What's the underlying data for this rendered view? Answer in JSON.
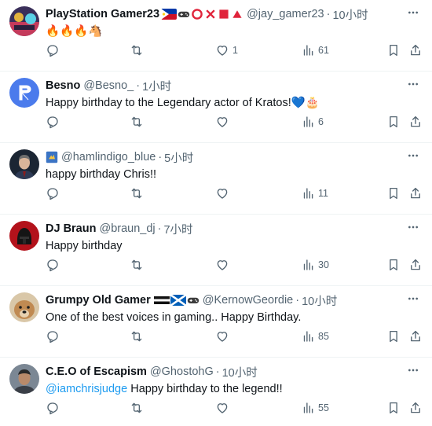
{
  "replies": [
    {
      "name": "PlayStation Gamer23",
      "handle": "@jay_gamer23",
      "dot": "·",
      "time": "10小时",
      "body": "🔥🔥🔥🐴",
      "likes": "1",
      "views": "61",
      "avatar_color": "#3a2f5a"
    },
    {
      "name": "Besno",
      "handle": "@Besno_",
      "dot": "·",
      "time": "1小时",
      "body": "Happy birthday to the Legendary actor of Kratos!💙🎂",
      "likes": "",
      "views": "6",
      "avatar_color": "#4b7bec"
    },
    {
      "name": "",
      "handle": "@hamlindigo_blue",
      "dot": "·",
      "time": "5小时",
      "body": "happy birthday Chris!!",
      "likes": "",
      "views": "11",
      "avatar_color": "#1b2533"
    },
    {
      "name": "DJ Braun",
      "handle": "@braun_dj",
      "dot": "·",
      "time": "7小时",
      "body": "Happy birthday",
      "likes": "",
      "views": "30",
      "avatar_color": "#b3121b"
    },
    {
      "name": "Grumpy Old Gamer",
      "handle": "@KernowGeordie",
      "dot": "·",
      "time": "10小时",
      "body": "One of the best voices in gaming.. Happy Birthday.",
      "likes": "",
      "views": "85",
      "avatar_color": "#c08a52"
    },
    {
      "name": "C.E.O of Escapism",
      "handle": "@GhostohG",
      "dot": "·",
      "time": "10小时",
      "mention": "@iamchrisjudge",
      "body": " Happy birthday to the legend!!",
      "likes": "",
      "views": "55",
      "avatar_color": "#7b8794"
    }
  ],
  "icons": {
    "more": "more-icon",
    "reply": "reply-icon",
    "retweet": "retweet-icon",
    "like": "heart-icon",
    "views": "views-icon",
    "bookmark": "bookmark-icon",
    "share": "share-icon"
  },
  "colors": {
    "text": "#0f1419",
    "secondary": "#536471",
    "link": "#1d9bf0",
    "divider": "#eff3f4"
  }
}
